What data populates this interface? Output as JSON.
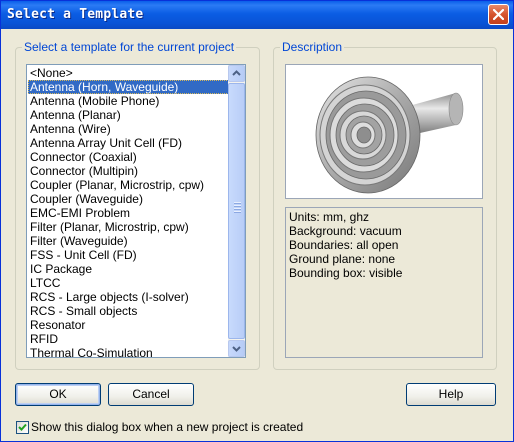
{
  "window": {
    "title": "Select a Template"
  },
  "left_group": {
    "label": "Select a template for the current project",
    "items": [
      "<None>",
      "Antenna (Horn, Waveguide)",
      "Antenna (Mobile Phone)",
      "Antenna (Planar)",
      "Antenna (Wire)",
      "Antenna Array Unit Cell (FD)",
      "Connector (Coaxial)",
      "Connector (Multipin)",
      "Coupler (Planar, Microstrip, cpw)",
      "Coupler (Waveguide)",
      "EMC-EMI Problem",
      "Filter (Planar, Microstrip, cpw)",
      "Filter (Waveguide)",
      "FSS - Unit Cell (FD)",
      "IC Package",
      "LTCC",
      "RCS - Large objects (I-solver)",
      "RCS - Small objects",
      "Resonator",
      "RFID",
      "Thermal Co-Simulation"
    ],
    "selected": "Antenna (Horn, Waveguide)"
  },
  "right_group": {
    "label": "Description",
    "preview_icon": "horn-antenna-icon",
    "lines": [
      "Units: mm, ghz",
      "Background: vacuum",
      "Boundaries: all open",
      "Ground plane: none",
      "Bounding box: visible"
    ]
  },
  "buttons": {
    "ok": "OK",
    "cancel": "Cancel",
    "help": "Help"
  },
  "checkbox": {
    "label": "Show this dialog box when a new project is created",
    "checked": true
  },
  "colors": {
    "title_bar": "#0A5FEA",
    "selection": "#316AC5",
    "group_label": "#0046D5",
    "dialog_bg": "#ECE9D8"
  }
}
